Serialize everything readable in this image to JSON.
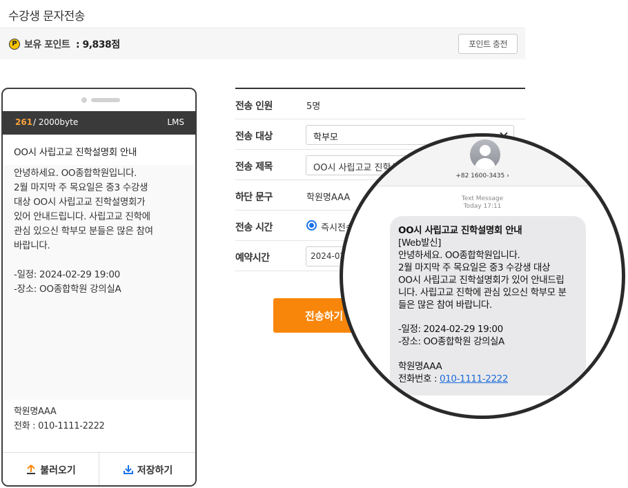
{
  "page": {
    "title": "수강생 문자전송"
  },
  "points": {
    "icon_letter": "P",
    "label": "보유 포인트",
    "value": ": 9,838점",
    "charge_button": "포인트 충전"
  },
  "phone": {
    "byte_count": "261",
    "byte_max": " / 2000byte",
    "msg_type": "LMS",
    "subject": "OO시 사립고교 진학설명회 안내",
    "body_lines": [
      "안녕하세요. OO종합학원입니다.",
      "2월 마지막 주 목요일은 중3 수강생",
      "대상 OO시 사립고교 진학설명회가",
      "있어 안내드립니다. 사립고교 진학에",
      "관심 있으신 학부모 분들은 많은 참여",
      "바랍니다.",
      "",
      "-일정: 2024-02-29 19:00",
      "-장소: OO종합학원 강의실A"
    ],
    "footer_lines": [
      "학원명AAA",
      "전화 : 010-1111-2222"
    ],
    "load_button": "불러오기",
    "save_button": "저장하기"
  },
  "form": {
    "recipients_label": "전송 인원",
    "recipients_value": "5명",
    "target_label": "전송 대상",
    "target_value": "학부모",
    "subject_label": "전송 제목",
    "subject_value": "OO시 사립고교 진학설명회",
    "footer_label": "하단 문구",
    "footer_value": "학원명AAA",
    "time_label": "전송 시간",
    "time_option": "즉시전송",
    "reserve_label": "예약시간",
    "reserve_value": "2024-02",
    "send_button": "전송하기"
  },
  "zoom": {
    "contact_number": "+82 1600-3435 ›",
    "meta_type": "Text Message",
    "meta_time": "Today 17:11",
    "lines": [
      "OO시 사립고교 진학설명회 안내",
      "[Web발신]",
      "안녕하세요. OO종합학원입니다.",
      "2월 마지막 주 목요일은 중3 수강생 대상",
      "OO시 사립고교 진학설명회가 있어 안내드립",
      "니다. 사립고교 진학에 관심 있으신 학부모 분",
      "들은 많은 참여 바랍니다.",
      "",
      "-일정: 2024-02-29 19:00",
      "-장소: OO종합학원 강의실A",
      "",
      "학원명AAA"
    ],
    "phone_prefix": "전화번호 : ",
    "phone_link": "010-1111-2222"
  }
}
